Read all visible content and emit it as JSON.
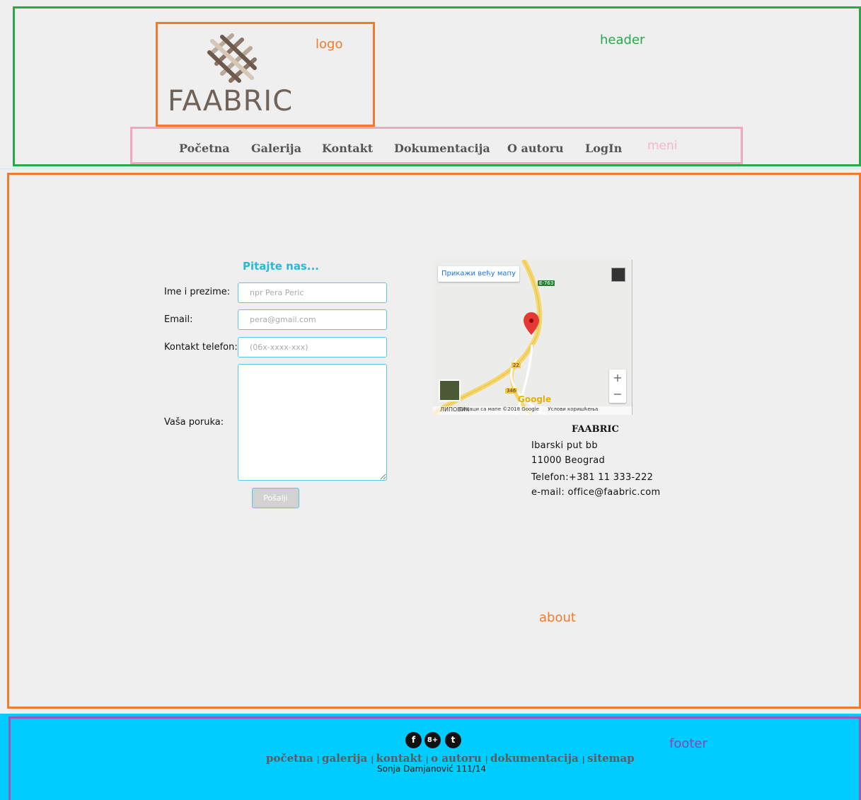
{
  "annotations": {
    "header": "header",
    "logo": "logo",
    "menu": "meni",
    "about": "about",
    "footer": "footer"
  },
  "logo": {
    "text": "FAABRIC"
  },
  "menu": {
    "items": [
      "Početna",
      "Galerija",
      "Kontakt",
      "Dokumentacija",
      "O autoru",
      "LogIn"
    ]
  },
  "form": {
    "title": "Pitajte nas...",
    "name_label": "Ime i prezime:",
    "name_placeholder": "npr Pera Peric",
    "email_label": "Email:",
    "email_placeholder": "pera@gmail.com",
    "phone_label": "Kontakt telefon:",
    "phone_placeholder": "(06x-xxxx-xxx)",
    "message_label": "Vaša poruka:",
    "submit_label": "Pošalji"
  },
  "map": {
    "larger_map_label": "Прикажи већу мапу",
    "roads": [
      "E-763",
      "22",
      "346"
    ],
    "place_label": "ЛИПОВИЧ",
    "google_label": "Google",
    "attribution": "Подаци са мапе ©2018 Google",
    "terms": "Услови коришћења",
    "zoom_in": "+",
    "zoom_out": "−"
  },
  "contact": {
    "company": "FAABRIC",
    "street": "Ibarski put bb",
    "city": "11000 Beograd",
    "phone": "Telefon:+381 11 333-222",
    "email": "e-mail: office@faabric.com"
  },
  "footer": {
    "social": [
      "f",
      "8+",
      "t"
    ],
    "links": [
      "početna",
      "galerija",
      "kontakt",
      "o autoru",
      "dokumentacija",
      "sitemap"
    ],
    "credit": "Sonja Damjanović 111/14"
  },
  "colors": {
    "header_outline": "#27a84a",
    "logo_outline": "#f07b2d",
    "menu_outline": "#f3a6c1",
    "footer_outline": "#9b59b6",
    "footer_background": "#00ccff",
    "accent_cyan": "#2ab8d8"
  }
}
